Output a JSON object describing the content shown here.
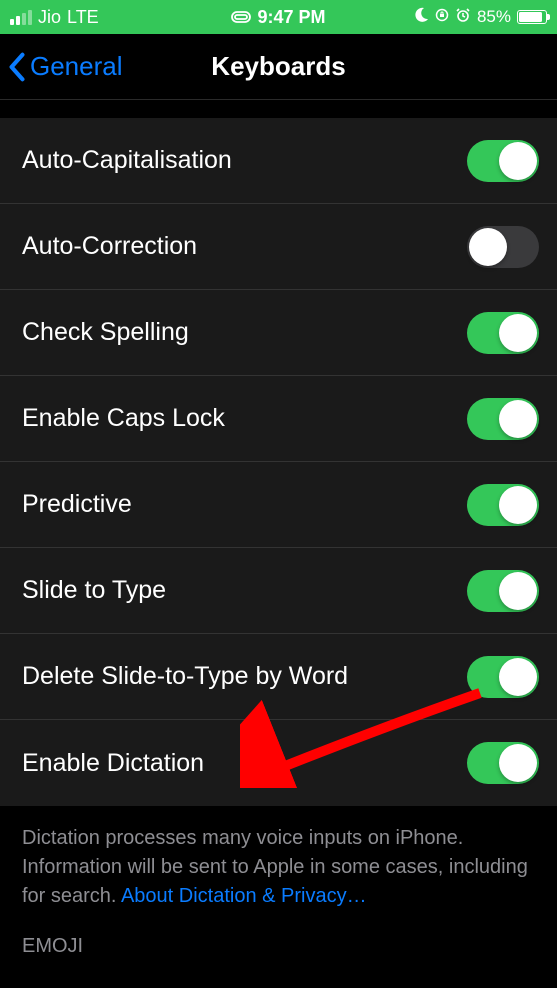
{
  "status": {
    "carrier": "Jio",
    "network": "LTE",
    "time": "9:47 PM",
    "battery_pct": "85%"
  },
  "nav": {
    "back_label": "General",
    "title": "Keyboards"
  },
  "settings": [
    {
      "label": "Auto-Capitalisation",
      "on": true
    },
    {
      "label": "Auto-Correction",
      "on": false
    },
    {
      "label": "Check Spelling",
      "on": true
    },
    {
      "label": "Enable Caps Lock",
      "on": true
    },
    {
      "label": "Predictive",
      "on": true
    },
    {
      "label": "Slide to Type",
      "on": true
    },
    {
      "label": "Delete Slide-to-Type by Word",
      "on": true
    },
    {
      "label": "Enable Dictation",
      "on": true
    }
  ],
  "footer": {
    "text": "Dictation processes many voice inputs on iPhone. Information will be sent to Apple in some cases, including for search. ",
    "link": "About Dictation & Privacy…"
  },
  "cutoff_text": "EMOJI"
}
